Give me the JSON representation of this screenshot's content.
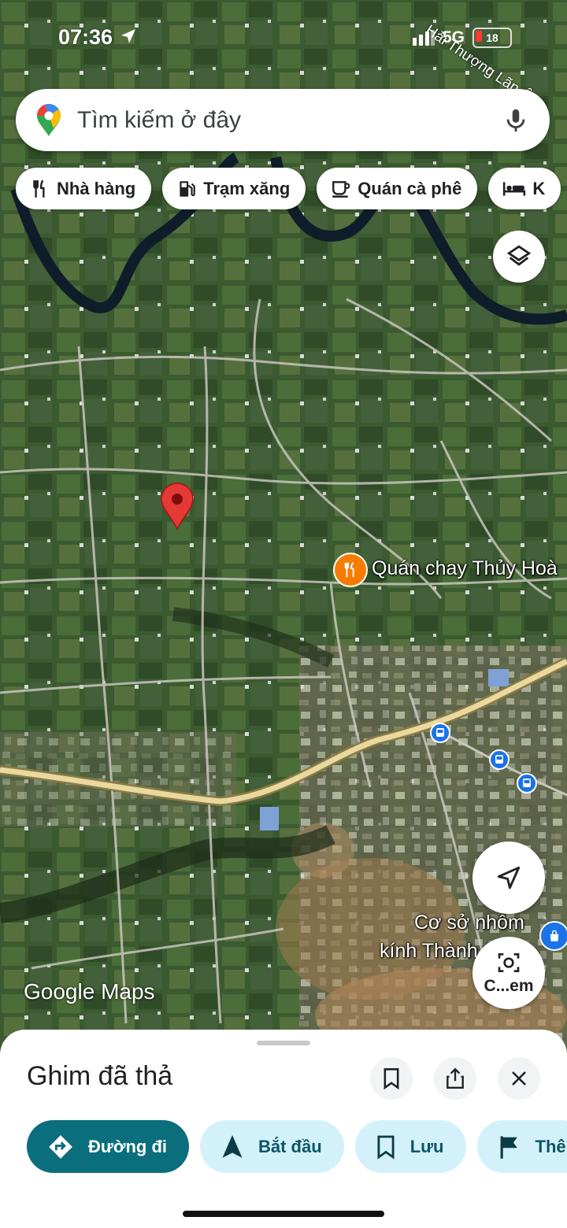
{
  "status_bar": {
    "time": "07:36",
    "network": "5G",
    "battery": "18"
  },
  "map": {
    "street_label": "Hải Thượng Lãn Ông",
    "poi_restaurant": "Quán chay Thủy Hoà",
    "poi_business_line1": "Cơ sở nhôm",
    "poi_business_line2": "kính Thành",
    "watermark": "Google Maps",
    "camera_label": "C...em",
    "icons": [
      "location-arrow-icon",
      "layers-icon",
      "my-location-icon",
      "bus-stop-icon",
      "dropped-pin-icon",
      "restaurant-icon",
      "shopping-icon",
      "lens-camera-icon"
    ]
  },
  "search": {
    "placeholder": "Tìm kiếm ở đây"
  },
  "chips": [
    {
      "label": "Nhà hàng",
      "icon": "restaurant-icon"
    },
    {
      "label": "Trạm xăng",
      "icon": "gas-station-icon"
    },
    {
      "label": "Quán cà phê",
      "icon": "coffee-icon"
    },
    {
      "label": "K",
      "icon": "hotel-icon"
    }
  ],
  "sheet": {
    "title": "Ghim đã thả",
    "actions": [
      {
        "label": "Đường đi",
        "icon": "directions-icon"
      },
      {
        "label": "Bắt đầu",
        "icon": "navigation-icon"
      },
      {
        "label": "Lưu",
        "icon": "bookmark-icon"
      },
      {
        "label": "Thê",
        "icon": "flag-icon"
      }
    ]
  },
  "colors": {
    "primary_action": "#0a6e7d",
    "secondary_action": "#d3f1fa",
    "pin_red": "#e53935",
    "poi_orange": "#f57c00",
    "transit_blue": "#1a73e8"
  }
}
